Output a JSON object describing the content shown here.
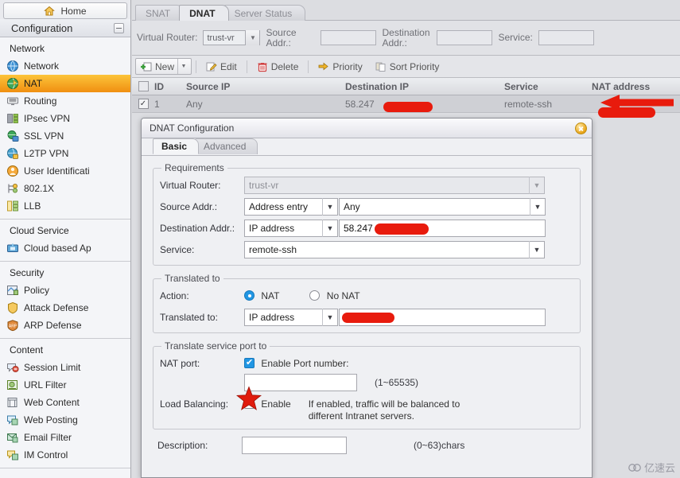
{
  "sidebar": {
    "home_label": "Home",
    "config_label": "Configuration",
    "groups": [
      {
        "title": "Network",
        "items": [
          {
            "label": "Network",
            "icon": "globe-icon",
            "active": false
          },
          {
            "label": "NAT",
            "icon": "nat-globe-icon",
            "active": true
          },
          {
            "label": "Routing",
            "icon": "routing-icon",
            "active": false
          },
          {
            "label": "IPsec VPN",
            "icon": "ipsec-vpn-icon",
            "active": false
          },
          {
            "label": "SSL VPN",
            "icon": "ssl-vpn-icon",
            "active": false
          },
          {
            "label": "L2TP VPN",
            "icon": "l2tp-vpn-icon",
            "active": false
          },
          {
            "label": "User Identificati",
            "icon": "user-identification-icon",
            "active": false
          },
          {
            "label": "802.1X",
            "icon": "dot1x-icon",
            "active": false
          },
          {
            "label": "LLB",
            "icon": "llb-icon",
            "active": false
          }
        ]
      },
      {
        "title": "Cloud Service",
        "items": [
          {
            "label": "Cloud based Ap",
            "icon": "cloud-app-icon",
            "active": false
          }
        ]
      },
      {
        "title": "Security",
        "items": [
          {
            "label": "Policy",
            "icon": "policy-icon",
            "active": false
          },
          {
            "label": "Attack Defense",
            "icon": "shield-icon",
            "active": false
          },
          {
            "label": "ARP Defense",
            "icon": "arp-defense-icon",
            "active": false
          }
        ]
      },
      {
        "title": "Content",
        "items": [
          {
            "label": "Session Limit",
            "icon": "session-limit-icon",
            "active": false
          },
          {
            "label": "URL Filter",
            "icon": "url-filter-icon",
            "active": false
          },
          {
            "label": "Web Content",
            "icon": "web-content-icon",
            "active": false
          },
          {
            "label": "Web Posting",
            "icon": "web-posting-icon",
            "active": false
          },
          {
            "label": "Email Filter",
            "icon": "email-filter-icon",
            "active": false
          },
          {
            "label": "IM Control",
            "icon": "im-control-icon",
            "active": false
          }
        ]
      }
    ]
  },
  "main": {
    "tabs": [
      {
        "label": "SNAT",
        "active": false
      },
      {
        "label": "DNAT",
        "active": true
      },
      {
        "label": "Server Status",
        "active": false
      }
    ],
    "filter": {
      "virtual_router_label": "Virtual Router:",
      "virtual_router_value": "trust-vr",
      "source_addr_label": "Source Addr.:",
      "source_addr_value": "",
      "destination_addr_label": "Destination Addr.:",
      "destination_addr_value": "",
      "service_label": "Service:",
      "service_value": ""
    },
    "toolbar": {
      "new_label": "New",
      "edit_label": "Edit",
      "delete_label": "Delete",
      "priority_label": "Priority",
      "sort_priority_label": "Sort Priority"
    },
    "table": {
      "columns": [
        "",
        "ID",
        "Source IP",
        "Destination IP",
        "Service",
        "NAT address"
      ],
      "rows": [
        {
          "checked": true,
          "id": "1",
          "source_ip": "Any",
          "destination_ip": "58.247",
          "destination_ip_redacted": true,
          "service": "remote-ssh",
          "nat_address": "",
          "nat_address_redacted": true
        }
      ]
    }
  },
  "dialog": {
    "title": "DNAT Configuration",
    "tabs": [
      {
        "label": "Basic",
        "active": true
      },
      {
        "label": "Advanced",
        "active": false
      }
    ],
    "requirements": {
      "legend": "Requirements",
      "virtual_router_label": "Virtual Router:",
      "virtual_router_value": "trust-vr",
      "source_addr_label": "Source Addr.:",
      "source_addr_type": "Address entry",
      "source_addr_value": "Any",
      "destination_addr_label": "Destination Addr.:",
      "destination_addr_type": "IP address",
      "destination_addr_value": "58.247",
      "service_label": "Service:",
      "service_value": "remote-ssh"
    },
    "translated_to": {
      "legend": "Translated to",
      "action_label": "Action:",
      "action_nat_label": "NAT",
      "action_nonat_label": "No NAT",
      "action_selected": "NAT",
      "translated_to_label": "Translated to:",
      "translated_to_type": "IP address",
      "translated_to_value": ""
    },
    "translate_port": {
      "legend": "Translate service port to",
      "nat_port_label": "NAT port:",
      "enable_port_label": "Enable Port number:",
      "enable_port_checked": true,
      "port_value": "",
      "port_range_hint": "(1~65535)",
      "load_balancing_label": "Load Balancing:",
      "load_balancing_enable_label": "Enable",
      "load_balancing_checked": false,
      "load_balancing_hint_line1": "If enabled, traffic will be balanced to",
      "load_balancing_hint_line2": "different Intranet servers."
    },
    "description_label": "Description:",
    "description_value": "",
    "description_hint": "(0~63)chars"
  },
  "annotations": {
    "arrow": "red-left-arrow",
    "star": "red-star"
  },
  "watermark": {
    "text": "亿速云"
  },
  "colors": {
    "accent_orange": "#f5a312",
    "annotation_red": "#e81b0d",
    "radio_blue": "#2196e3"
  }
}
